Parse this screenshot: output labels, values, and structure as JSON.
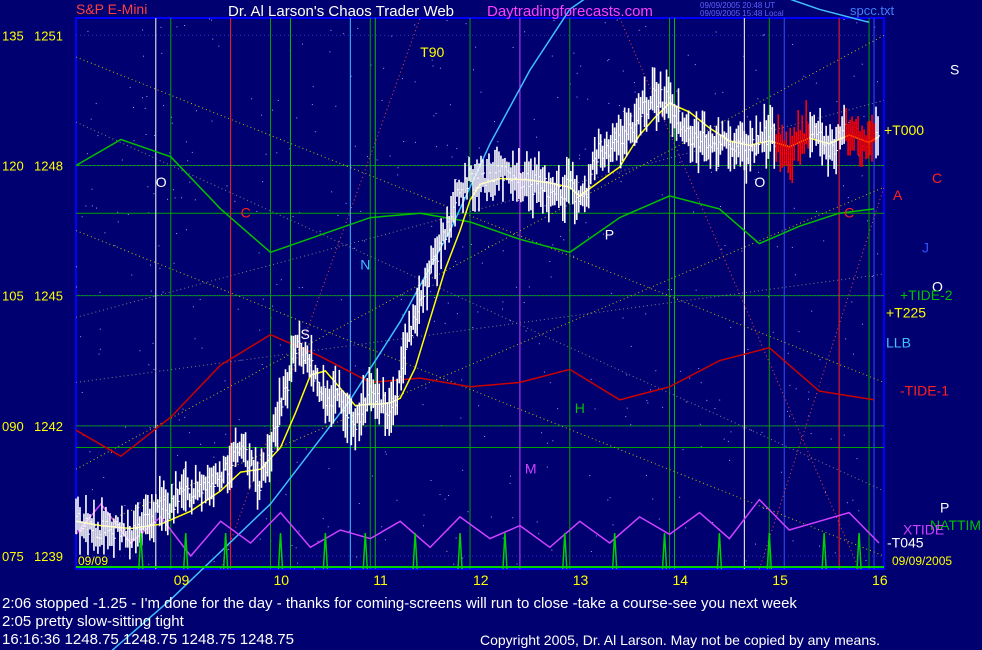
{
  "header": {
    "symbol_label": "S&P E-Mini",
    "title_main": "Dr. Al Larson's Chaos Trader Web",
    "title_site": "Daytradingforecasts.com",
    "timestamp_1": "09/09/2005 20:48 UT",
    "timestamp_2": "09/09/2005 15:48 Local",
    "file_name": "spcc.txt"
  },
  "messages": [
    "2:06 stopped -1.25 - I'm done for the day - thanks for coming-screens will run to close -take a course-see you next week",
    "2:05 pretty slow-sitting tight"
  ],
  "quote_line": "16:16:36   1248.75 1248.75 1248.75 1248.75",
  "copyright": "Copyright 2005, Dr. Al Larson. May not be copied by any means.",
  "colors": {
    "background": "#000070",
    "price_bars": "#ffffff",
    "lower_trade_bars": "#ff0000",
    "tide_upper": "#00c000",
    "tide_lower": "#cc0000",
    "cyan_curve": "#40c0ff",
    "magenta_oscillator": "#d040ff",
    "yellow_average": "#ffff00",
    "pink_text": "#ff40ff",
    "axis_blue": "#0000ff"
  },
  "chart_data": {
    "type": "line",
    "title": "S&P E-Mini",
    "x_range": [
      8.05,
      16.15
    ],
    "y_range": [
      1238.7,
      1251.4
    ],
    "y_ticks": [
      {
        "left": "075",
        "right": "1239",
        "value": 1239
      },
      {
        "left": "090",
        "right": "1242",
        "value": 1242
      },
      {
        "left": "105",
        "right": "1245",
        "value": 1245
      },
      {
        "left": "120",
        "right": "1248",
        "value": 1248
      },
      {
        "left": "135",
        "right": "1251",
        "value": 1251
      }
    ],
    "x_ticks": [
      {
        "label": "09",
        "value": 9
      },
      {
        "label": "10",
        "value": 10
      },
      {
        "label": "11",
        "value": 11
      },
      {
        "label": "12",
        "value": 12
      },
      {
        "label": "13",
        "value": 13
      },
      {
        "label": "14",
        "value": 14
      },
      {
        "label": "15",
        "value": 15
      },
      {
        "label": "16",
        "value": 16
      }
    ],
    "date_left": "09/09",
    "date_right": "09/09/2005",
    "price_series": {
      "x": [
        8.05,
        8.3,
        8.6,
        8.9,
        9.2,
        9.5,
        9.7,
        9.9,
        10.1,
        10.25,
        10.4,
        10.55,
        10.7,
        10.85,
        11.0,
        11.1,
        11.2,
        11.3,
        11.45,
        11.6,
        11.75,
        11.9,
        12.0,
        12.1,
        12.3,
        12.6,
        12.8,
        13.0,
        13.1,
        13.3,
        13.5,
        13.7,
        13.85,
        14.0,
        14.2,
        14.4,
        14.6,
        14.8,
        15.0,
        15.2,
        15.4,
        15.6,
        15.8,
        16.0,
        16.1
      ],
      "y": [
        1239.8,
        1239.6,
        1239.5,
        1240.1,
        1240.5,
        1240.9,
        1241.4,
        1240.7,
        1242.4,
        1243.8,
        1243.3,
        1242.7,
        1242.6,
        1242.1,
        1242.8,
        1242.6,
        1242.2,
        1243.1,
        1244.7,
        1245.6,
        1246.5,
        1247.4,
        1247.7,
        1247.6,
        1247.8,
        1247.6,
        1247.4,
        1247.5,
        1247.0,
        1248.4,
        1248.5,
        1249.2,
        1249.6,
        1249.5,
        1248.6,
        1248.5,
        1248.6,
        1248.3,
        1248.8,
        1248.2,
        1248.9,
        1248.4,
        1248.8,
        1248.4,
        1248.8
      ]
    },
    "red_bar_segments": [
      {
        "x0": 15.05,
        "x1": 15.4
      },
      {
        "x0": 15.75,
        "x1": 16.05
      }
    ],
    "horizontal_levels": [
      1248.0,
      1245.0,
      1242.0,
      1241.5,
      1246.9
    ],
    "vertical_lines": [
      {
        "x": 8.85,
        "color": "white"
      },
      {
        "x": 9.6,
        "color": "red"
      },
      {
        "x": 10.2,
        "color": "green"
      },
      {
        "x": 10.8,
        "color": "cyan"
      },
      {
        "x": 11.05,
        "color": "green"
      },
      {
        "x": 12.5,
        "color": "magenta"
      },
      {
        "x": 14.05,
        "color": "green"
      },
      {
        "x": 14.75,
        "color": "white"
      },
      {
        "x": 15.15,
        "color": "blue"
      },
      {
        "x": 15.7,
        "color": "red"
      },
      {
        "x": 16.05,
        "color": "blue"
      }
    ],
    "cyan_curve": {
      "x": [
        8.3,
        9.0,
        10.0,
        10.8,
        11.3,
        11.8,
        12.2,
        12.6,
        13.0,
        13.5,
        14.0,
        14.5,
        15.0,
        15.5,
        16.0
      ],
      "y": [
        1236.6,
        1238.0,
        1240.2,
        1242.6,
        1244.4,
        1246.5,
        1248.5,
        1250.2,
        1251.6,
        1252.4,
        1252.6,
        1252.4,
        1252.0,
        1251.6,
        1251.3
      ]
    },
    "green_tide_curve": {
      "x": [
        8.05,
        8.5,
        9.0,
        9.5,
        10.0,
        10.5,
        11.0,
        11.5,
        12.0,
        12.5,
        13.0,
        13.5,
        14.0,
        14.5,
        14.9,
        15.3,
        15.7,
        16.05
      ],
      "y": [
        1248.0,
        1248.6,
        1248.2,
        1247.0,
        1246.0,
        1246.4,
        1246.8,
        1246.9,
        1246.7,
        1246.3,
        1246.0,
        1246.8,
        1247.3,
        1247.0,
        1246.2,
        1246.6,
        1246.9,
        1247.0
      ]
    },
    "red_tide_curve": {
      "x": [
        8.05,
        8.5,
        9.0,
        9.5,
        10.0,
        10.5,
        11.0,
        11.5,
        12.0,
        12.5,
        13.0,
        13.5,
        14.0,
        14.5,
        15.0,
        15.5,
        16.05
      ],
      "y": [
        1241.9,
        1241.3,
        1242.2,
        1243.4,
        1244.1,
        1243.6,
        1243.0,
        1243.1,
        1242.9,
        1243.0,
        1243.3,
        1242.6,
        1242.9,
        1243.5,
        1243.8,
        1242.8,
        1242.6
      ]
    },
    "magenta_oscillator": {
      "x": [
        8.05,
        8.3,
        8.6,
        8.9,
        9.2,
        9.5,
        9.8,
        10.1,
        10.4,
        10.7,
        11.0,
        11.3,
        11.6,
        11.9,
        12.2,
        12.5,
        12.8,
        13.1,
        13.4,
        13.7,
        14.0,
        14.3,
        14.6,
        14.9,
        15.2,
        15.5,
        15.8,
        16.1
      ],
      "y": [
        1239.5,
        1240.2,
        1239.3,
        1239.9,
        1239.0,
        1239.8,
        1239.3,
        1240.0,
        1239.2,
        1239.6,
        1239.4,
        1239.8,
        1239.2,
        1239.9,
        1239.4,
        1239.7,
        1239.2,
        1239.8,
        1239.3,
        1239.9,
        1239.5,
        1240.0,
        1239.4,
        1240.3,
        1239.6,
        1239.8,
        1240.0,
        1239.3
      ]
    },
    "tick_spikes_x": [
      8.7,
      9.15,
      9.55,
      10.1,
      10.55,
      10.95,
      11.45,
      11.9,
      12.35,
      12.95,
      13.45,
      13.95,
      14.5,
      15.0,
      15.55,
      15.9
    ],
    "cycle_letters": [
      {
        "text": "T90",
        "x": 11.5,
        "y": 1250.5,
        "color": "yellow"
      },
      {
        "text": "O",
        "x": 8.85,
        "y": 1247.5,
        "color": "white"
      },
      {
        "text": "C",
        "x": 9.7,
        "y": 1246.8,
        "color": "red"
      },
      {
        "text": "N",
        "x": 10.9,
        "y": 1245.6,
        "color": "cyan"
      },
      {
        "text": "S",
        "x": 10.3,
        "y": 1244.0,
        "color": "white"
      },
      {
        "text": "P",
        "x": 13.35,
        "y": 1246.3,
        "color": "white"
      },
      {
        "text": "H",
        "x": 13.05,
        "y": 1242.3,
        "color": "green"
      },
      {
        "text": "M",
        "x": 12.55,
        "y": 1240.9,
        "color": "magenta"
      },
      {
        "text": "O",
        "x": 14.85,
        "y": 1247.5,
        "color": "white"
      },
      {
        "text": "C",
        "x": 15.75,
        "y": 1246.8,
        "color": "red"
      }
    ],
    "right_labels": [
      {
        "text": "S",
        "y": 1250.1,
        "color": "white"
      },
      {
        "text": "C",
        "y": 1247.6,
        "color": "red"
      },
      {
        "text": "A",
        "y": 1247.2,
        "color": "red"
      },
      {
        "text": "J",
        "y": 1246.0,
        "color": "blue"
      },
      {
        "text": "O",
        "y": 1245.1,
        "color": "white"
      },
      {
        "text": "+TIDE-2",
        "y": 1244.9,
        "color": "green"
      },
      {
        "text": "+T225",
        "y": 1244.5,
        "color": "yellow"
      },
      {
        "text": "LLB",
        "y": 1243.8,
        "color": "cyan"
      },
      {
        "text": "-TIDE-1",
        "y": 1242.7,
        "color": "red"
      },
      {
        "text": "P",
        "y": 1240.0,
        "color": "white"
      },
      {
        "text": "NATTIM",
        "y": 1239.6,
        "color": "green"
      },
      {
        "text": "XTIDE",
        "y": 1239.5,
        "color": "magenta"
      },
      {
        "text": "-T045",
        "y": 1239.2,
        "color": "white"
      },
      {
        "text": "+T000",
        "y": 1248.7,
        "color": "yellow"
      }
    ]
  }
}
